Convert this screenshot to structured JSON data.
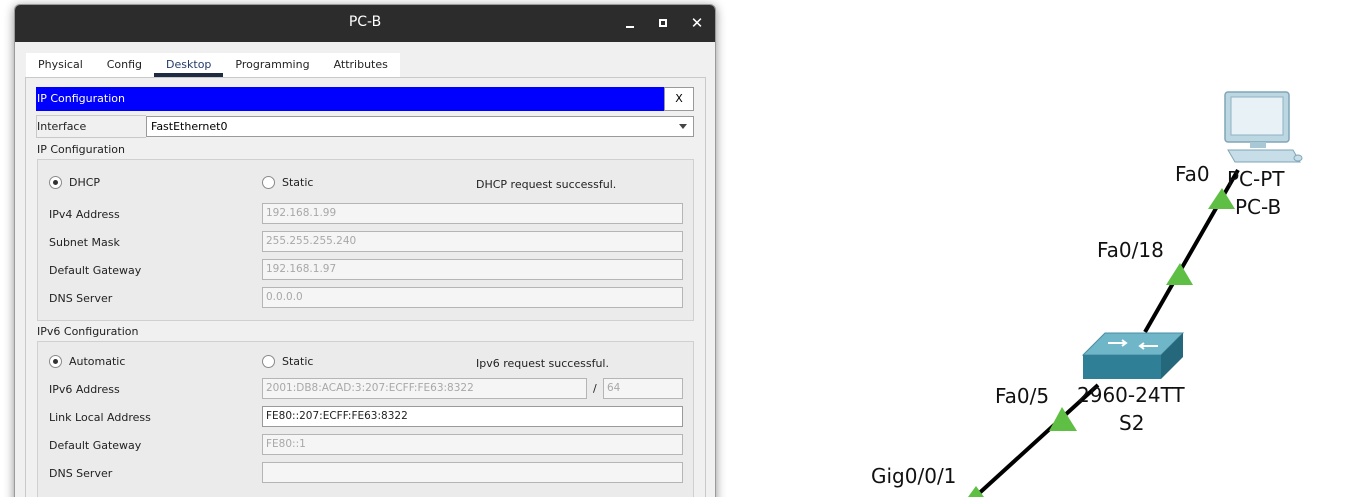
{
  "window": {
    "title": "PC-B",
    "tabs": [
      "Physical",
      "Config",
      "Desktop",
      "Programming",
      "Attributes"
    ],
    "active_tab": "Desktop"
  },
  "ipconfig": {
    "header": "IP Configuration",
    "close_label": "X",
    "interface_label": "Interface",
    "interface_value": "FastEthernet0",
    "ipv4": {
      "section_title": "IP Configuration",
      "dhcp_label": "DHCP",
      "static_label": "Static",
      "status": "DHCP request successful.",
      "selected": "DHCP",
      "fields": [
        {
          "label": "IPv4 Address",
          "value": "192.168.1.99"
        },
        {
          "label": "Subnet Mask",
          "value": "255.255.255.240"
        },
        {
          "label": "Default Gateway",
          "value": "192.168.1.97"
        },
        {
          "label": "DNS Server",
          "value": "0.0.0.0"
        }
      ]
    },
    "ipv6": {
      "section_title": "IPv6 Configuration",
      "auto_label": "Automatic",
      "static_label": "Static",
      "status": "Ipv6 request successful.",
      "selected": "Automatic",
      "address_label": "IPv6 Address",
      "address_value": "2001:DB8:ACAD:3:207:ECFF:FE63:8322",
      "slash": "/",
      "prefix_value": "64",
      "link_local_label": "Link Local Address",
      "link_local_value": "FE80::207:ECFF:FE63:8322",
      "gateway_label": "Default Gateway",
      "gateway_value": "FE80::1",
      "dns_label": "DNS Server",
      "dns_value": ""
    }
  },
  "topology": {
    "pc_type": "PC-PT",
    "pc_name": "PC-B",
    "pc_port": "Fa0",
    "switch_upper_port": "Fa0/18",
    "switch_type": "2960-24TT",
    "switch_name": "S2",
    "switch_lower_port": "Fa0/5",
    "router_port": "Gig0/0/1",
    "link_color": "#000000",
    "port_indicator_color": "#5fbf45"
  },
  "colors": {
    "titlebar": "#2c2c2c",
    "header_bar": "#0000ff",
    "active_tab_underline": "#1e2b43"
  }
}
